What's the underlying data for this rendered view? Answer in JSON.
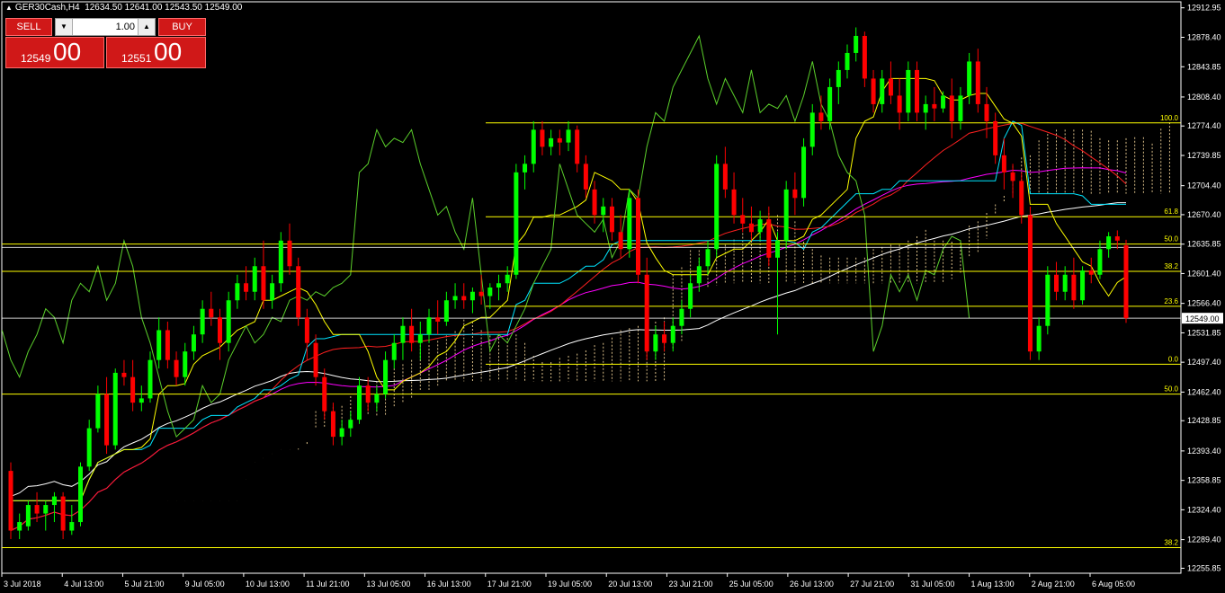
{
  "header": {
    "symbol": "GER30Cash,H4",
    "ohlc": "12634.50 12641.00 12543.50 12549.00"
  },
  "trade_panel": {
    "sell_label": "SELL",
    "buy_label": "BUY",
    "lot_value": "1.00",
    "sell_price_small": "12549",
    "sell_price_big": "00",
    "buy_price_small": "12551",
    "buy_price_big": "00"
  },
  "colors": {
    "bull": "#00ff00",
    "bear": "#ff0000",
    "fib": "#ffff00",
    "tenkan": "#ffff00",
    "kijun": "#00e5ff",
    "chikou": "#5bcf2b",
    "ma_slow": "#ffffff",
    "ma_mid": "#ff00ff",
    "ma_fast": "#ff2020",
    "cloud_a": "#ffb0b0",
    "cloud_b": "#ffe0a0",
    "bg": "#000000"
  },
  "chart_data": {
    "type": "candlestick",
    "y_ticks": [
      "12912.95",
      "12878.40",
      "12843.85",
      "12808.40",
      "12774.40",
      "12739.85",
      "12704.40",
      "12670.40",
      "12635.85",
      "12601.40",
      "12566.40",
      "12531.85",
      "12497.40",
      "12462.40",
      "12428.85",
      "12393.40",
      "12358.85",
      "12324.40",
      "12289.40",
      "12255.85"
    ],
    "ylim": [
      12250,
      12920
    ],
    "x_labels": [
      "3 Jul 2018",
      "4 Jul 13:00",
      "5 Jul 21:00",
      "9 Jul 05:00",
      "10 Jul 13:00",
      "11 Jul 21:00",
      "13 Jul 05:00",
      "16 Jul 13:00",
      "17 Jul 21:00",
      "19 Jul 05:00",
      "20 Jul 13:00",
      "23 Jul 21:00",
      "25 Jul 05:00",
      "26 Jul 13:00",
      "27 Jul 21:00",
      "31 Jul 05:00",
      "1 Aug 13:00",
      "2 Aug 21:00",
      "6 Aug 05:00"
    ],
    "current_price": "12549.00",
    "fib_levels": [
      {
        "label": "100.0",
        "price": 12778
      },
      {
        "label": "61.8",
        "price": 12668
      },
      {
        "label": "50.0",
        "price": 12636
      },
      {
        "label": "38.2",
        "price": 12604
      },
      {
        "label": "23.6",
        "price": 12563
      },
      {
        "label": "0.0",
        "price": 12495
      },
      {
        "label": "50.0",
        "price": 12460
      },
      {
        "label": "38.2",
        "price": 12280
      }
    ],
    "extra_lines": [
      12632,
      12549
    ],
    "candles": [
      [
        12370,
        12380,
        12290,
        12300
      ],
      [
        12300,
        12320,
        12290,
        12310
      ],
      [
        12305,
        12335,
        12300,
        12330
      ],
      [
        12330,
        12345,
        12310,
        12320
      ],
      [
        12320,
        12335,
        12300,
        12330
      ],
      [
        12330,
        12345,
        12310,
        12340
      ],
      [
        12340,
        12345,
        12290,
        12300
      ],
      [
        12300,
        12330,
        12295,
        12310
      ],
      [
        12310,
        12380,
        12305,
        12375
      ],
      [
        12375,
        12430,
        12370,
        12420
      ],
      [
        12420,
        12470,
        12415,
        12460
      ],
      [
        12460,
        12480,
        12390,
        12400
      ],
      [
        12400,
        12490,
        12395,
        12485
      ],
      [
        12485,
        12500,
        12470,
        12480
      ],
      [
        12480,
        12500,
        12440,
        12450
      ],
      [
        12450,
        12470,
        12440,
        12455
      ],
      [
        12455,
        12510,
        12450,
        12500
      ],
      [
        12500,
        12550,
        12490,
        12535
      ],
      [
        12535,
        12545,
        12490,
        12500
      ],
      [
        12500,
        12510,
        12470,
        12480
      ],
      [
        12480,
        12520,
        12470,
        12510
      ],
      [
        12510,
        12540,
        12500,
        12530
      ],
      [
        12530,
        12570,
        12520,
        12560
      ],
      [
        12560,
        12580,
        12540,
        12550
      ],
      [
        12550,
        12560,
        12500,
        12520
      ],
      [
        12520,
        12580,
        12510,
        12570
      ],
      [
        12570,
        12600,
        12560,
        12590
      ],
      [
        12590,
        12610,
        12570,
        12580
      ],
      [
        12580,
        12620,
        12570,
        12610
      ],
      [
        12610,
        12640,
        12560,
        12570
      ],
      [
        12570,
        12600,
        12560,
        12590
      ],
      [
        12590,
        12650,
        12580,
        12640
      ],
      [
        12640,
        12660,
        12600,
        12610
      ],
      [
        12610,
        12620,
        12540,
        12550
      ],
      [
        12550,
        12560,
        12500,
        12520
      ],
      [
        12520,
        12530,
        12470,
        12480
      ],
      [
        12480,
        12490,
        12430,
        12440
      ],
      [
        12440,
        12450,
        12400,
        12410
      ],
      [
        12410,
        12430,
        12400,
        12420
      ],
      [
        12420,
        12440,
        12410,
        12430
      ],
      [
        12430,
        12480,
        12425,
        12470
      ],
      [
        12470,
        12480,
        12440,
        12450
      ],
      [
        12450,
        12470,
        12440,
        12460
      ],
      [
        12460,
        12510,
        12455,
        12500
      ],
      [
        12500,
        12530,
        12490,
        12520
      ],
      [
        12520,
        12550,
        12500,
        12540
      ],
      [
        12540,
        12560,
        12510,
        12520
      ],
      [
        12520,
        12545,
        12500,
        12530
      ],
      [
        12530,
        12560,
        12520,
        12550
      ],
      [
        12550,
        12570,
        12530,
        12545
      ],
      [
        12545,
        12580,
        12540,
        12570
      ],
      [
        12570,
        12590,
        12560,
        12575
      ],
      [
        12575,
        12590,
        12560,
        12570
      ],
      [
        12570,
        12585,
        12555,
        12580
      ],
      [
        12580,
        12600,
        12565,
        12575
      ],
      [
        12575,
        12590,
        12560,
        12585
      ],
      [
        12585,
        12600,
        12570,
        12590
      ],
      [
        12590,
        12610,
        12580,
        12600
      ],
      [
        12600,
        12730,
        12595,
        12720
      ],
      [
        12720,
        12740,
        12700,
        12730
      ],
      [
        12730,
        12780,
        12720,
        12770
      ],
      [
        12770,
        12780,
        12740,
        12750
      ],
      [
        12750,
        12770,
        12740,
        12760
      ],
      [
        12760,
        12770,
        12740,
        12755
      ],
      [
        12755,
        12780,
        12745,
        12770
      ],
      [
        12770,
        12775,
        12720,
        12730
      ],
      [
        12730,
        12740,
        12690,
        12700
      ],
      [
        12700,
        12710,
        12660,
        12670
      ],
      [
        12670,
        12690,
        12650,
        12680
      ],
      [
        12680,
        12690,
        12640,
        12650
      ],
      [
        12650,
        12670,
        12620,
        12630
      ],
      [
        12630,
        12700,
        12620,
        12690
      ],
      [
        12690,
        12700,
        12590,
        12600
      ],
      [
        12600,
        12620,
        12500,
        12510
      ],
      [
        12510,
        12540,
        12500,
        12530
      ],
      [
        12530,
        12545,
        12510,
        12520
      ],
      [
        12520,
        12550,
        12510,
        12540
      ],
      [
        12540,
        12570,
        12530,
        12560
      ],
      [
        12560,
        12600,
        12550,
        12590
      ],
      [
        12590,
        12620,
        12580,
        12610
      ],
      [
        12610,
        12640,
        12600,
        12630
      ],
      [
        12630,
        12740,
        12620,
        12730
      ],
      [
        12730,
        12750,
        12690,
        12700
      ],
      [
        12700,
        12720,
        12660,
        12670
      ],
      [
        12670,
        12690,
        12650,
        12660
      ],
      [
        12660,
        12680,
        12640,
        12650
      ],
      [
        12650,
        12675,
        12640,
        12665
      ],
      [
        12665,
        12680,
        12610,
        12620
      ],
      [
        12620,
        12650,
        12530,
        12640
      ],
      [
        12640,
        12710,
        12630,
        12700
      ],
      [
        12700,
        12720,
        12670,
        12690
      ],
      [
        12690,
        12760,
        12680,
        12750
      ],
      [
        12750,
        12800,
        12740,
        12790
      ],
      [
        12790,
        12810,
        12770,
        12780
      ],
      [
        12780,
        12830,
        12770,
        12820
      ],
      [
        12820,
        12850,
        12800,
        12840
      ],
      [
        12840,
        12870,
        12830,
        12860
      ],
      [
        12860,
        12890,
        12850,
        12880
      ],
      [
        12880,
        12885,
        12820,
        12830
      ],
      [
        12830,
        12840,
        12790,
        12800
      ],
      [
        12800,
        12840,
        12790,
        12830
      ],
      [
        12830,
        12850,
        12800,
        12810
      ],
      [
        12810,
        12830,
        12770,
        12790
      ],
      [
        12790,
        12850,
        12780,
        12840
      ],
      [
        12840,
        12850,
        12780,
        12790
      ],
      [
        12790,
        12810,
        12770,
        12800
      ],
      [
        12800,
        12820,
        12780,
        12795
      ],
      [
        12795,
        12815,
        12790,
        12810
      ],
      [
        12810,
        12830,
        12760,
        12780
      ],
      [
        12780,
        12820,
        12770,
        12810
      ],
      [
        12810,
        12860,
        12800,
        12850
      ],
      [
        12850,
        12865,
        12790,
        12800
      ],
      [
        12800,
        12820,
        12760,
        12780
      ],
      [
        12780,
        12790,
        12730,
        12740
      ],
      [
        12740,
        12760,
        12700,
        12720
      ],
      [
        12720,
        12730,
        12690,
        12710
      ],
      [
        12710,
        12720,
        12660,
        12670
      ],
      [
        12670,
        12680,
        12500,
        12510
      ],
      [
        12510,
        12550,
        12500,
        12540
      ],
      [
        12540,
        12610,
        12530,
        12600
      ],
      [
        12600,
        12615,
        12570,
        12580
      ],
      [
        12580,
        12610,
        12570,
        12600
      ],
      [
        12600,
        12620,
        12560,
        12570
      ],
      [
        12570,
        12610,
        12565,
        12605
      ],
      [
        12605,
        12620,
        12590,
        12600
      ],
      [
        12600,
        12640,
        12595,
        12630
      ],
      [
        12630,
        12650,
        12620,
        12645
      ],
      [
        12645,
        12652,
        12630,
        12640
      ],
      [
        12634.5,
        12641,
        12543.5,
        12549
      ]
    ]
  }
}
